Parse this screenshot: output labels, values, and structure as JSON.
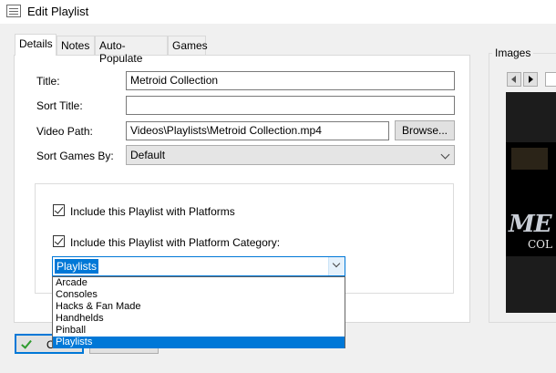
{
  "window": {
    "title": "Edit Playlist",
    "icon": "list-window-icon"
  },
  "tabs": [
    {
      "label": "Details",
      "active": true
    },
    {
      "label": "Notes",
      "active": false
    },
    {
      "label": "Auto-Populate",
      "active": false
    },
    {
      "label": "Games",
      "active": false
    }
  ],
  "details": {
    "title_label": "Title:",
    "title_value": "Metroid Collection",
    "sort_title_label": "Sort Title:",
    "sort_title_value": "",
    "video_path_label": "Video Path:",
    "video_path_value": "Videos\\Playlists\\Metroid Collection.mp4",
    "browse_label": "Browse...",
    "sort_games_label": "Sort Games By:",
    "sort_games_value": "Default"
  },
  "platform_options": {
    "include_platforms_label": "Include this Playlist with Platforms",
    "include_platforms_checked": true,
    "include_category_label": "Include this Playlist with Platform Category:",
    "include_category_checked": true,
    "category_selected": "Playlists",
    "category_options": [
      "Arcade",
      "Consoles",
      "Hacks & Fan Made",
      "Handhelds",
      "Pinball",
      "Playlists"
    ]
  },
  "images": {
    "label": "Images",
    "art_text_1": "ME",
    "art_text_2": "COL"
  },
  "footer": {
    "ok_label": "O"
  },
  "colors": {
    "accent": "#0078d7",
    "ok_check": "#2e9b2e"
  }
}
